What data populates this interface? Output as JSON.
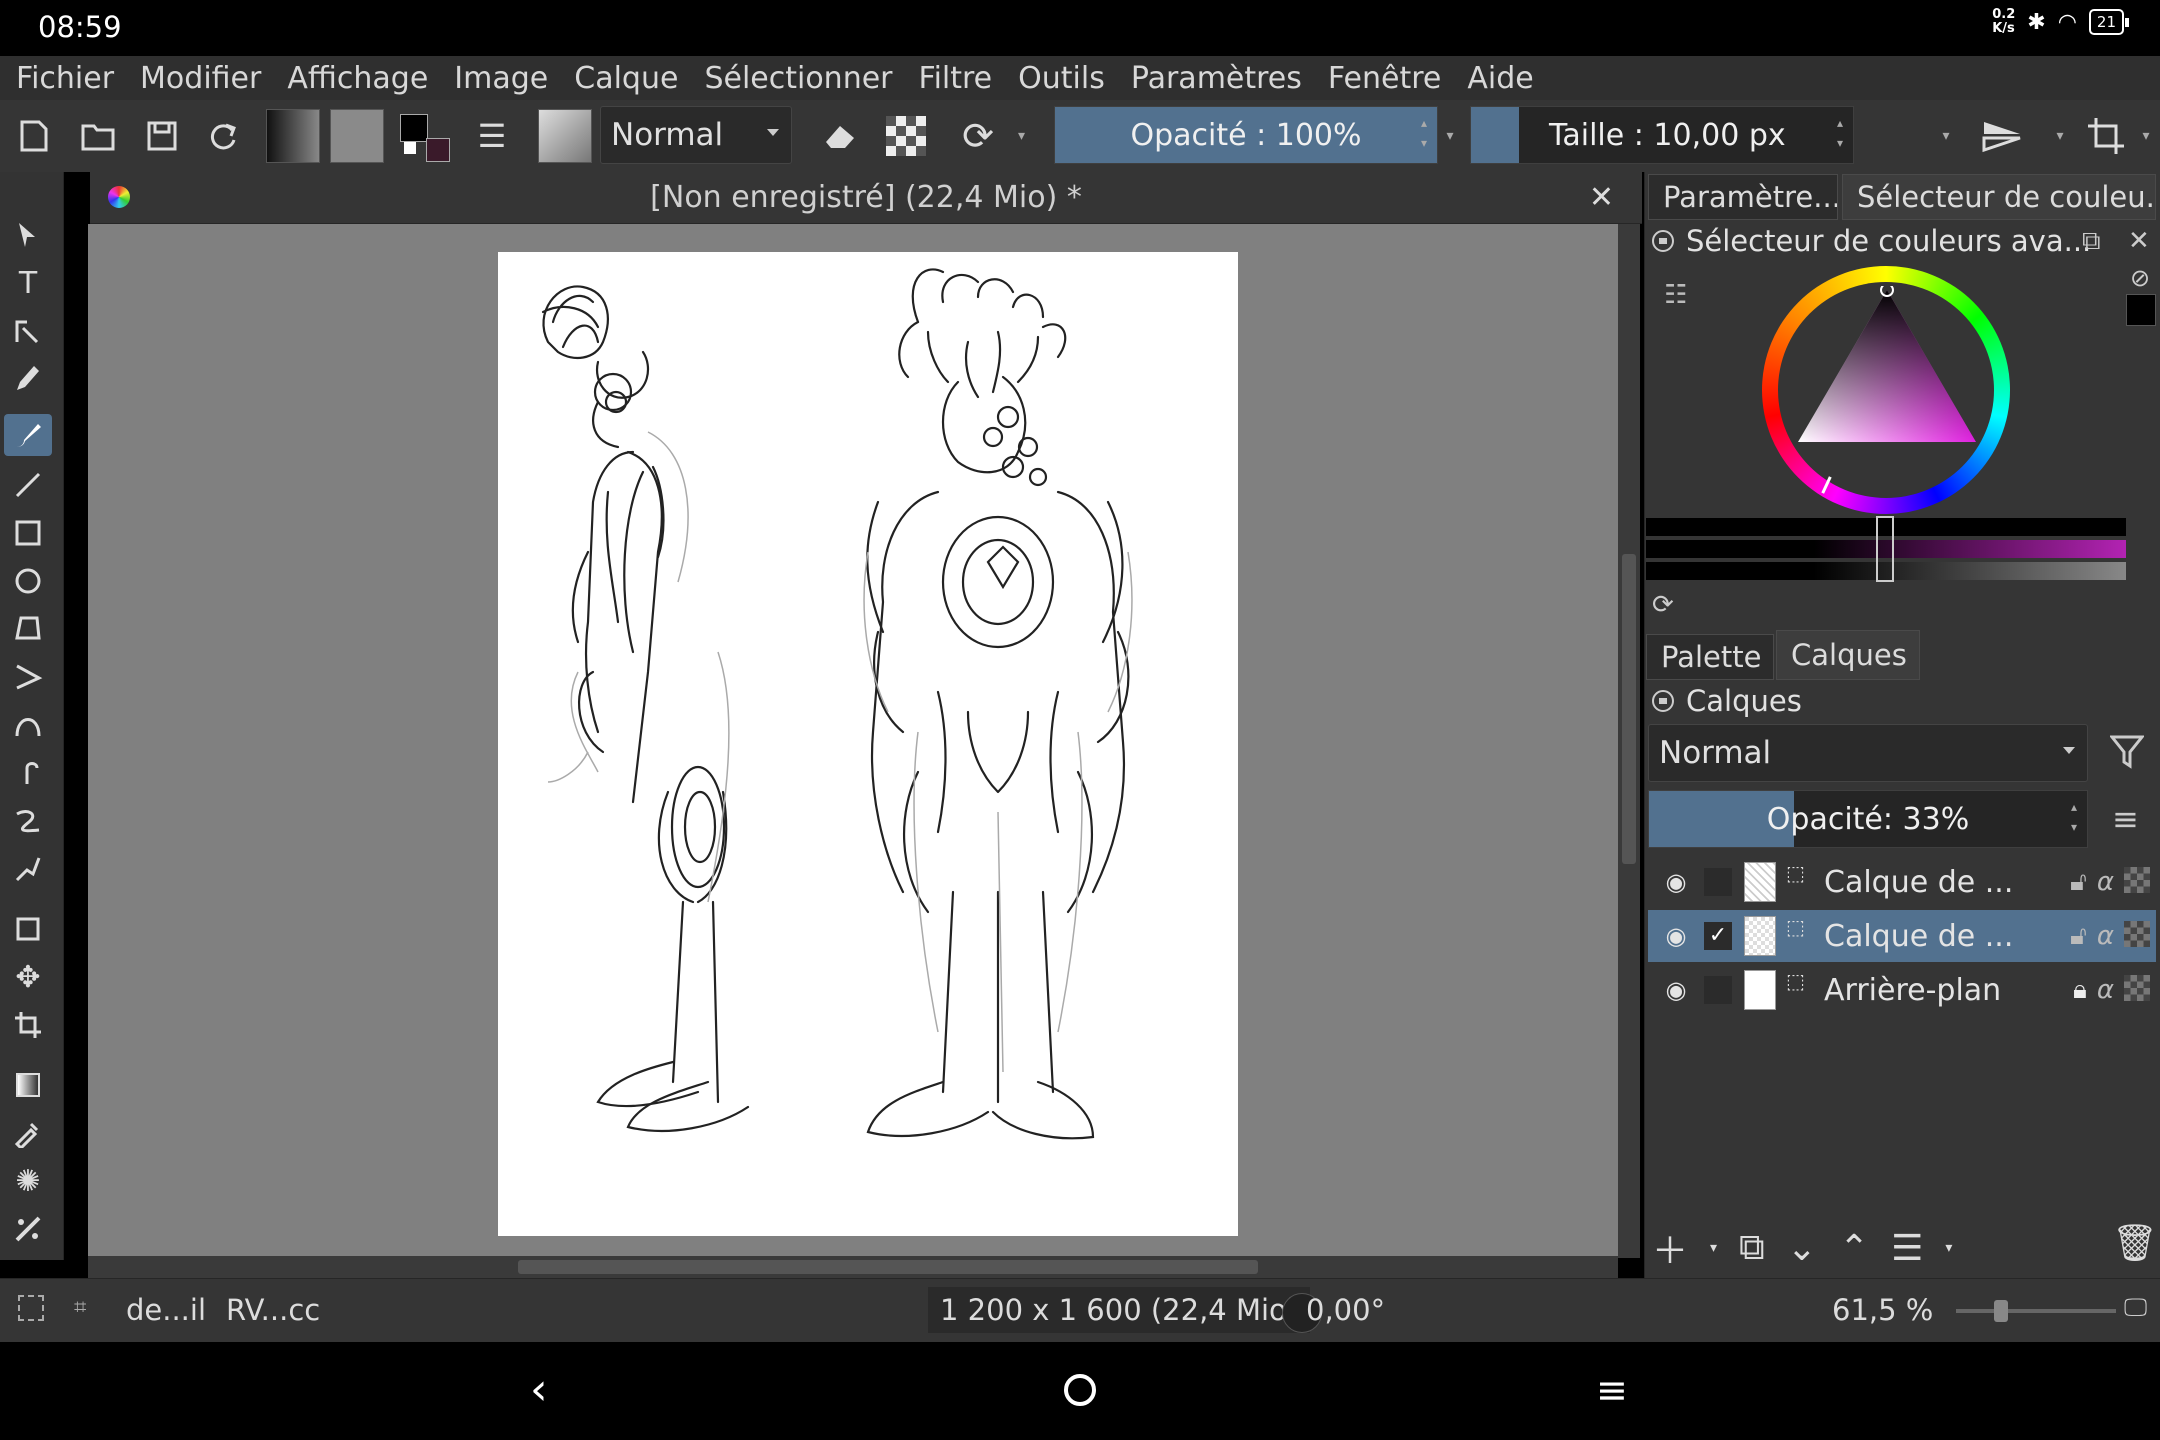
{
  "status": {
    "time": "08:59",
    "net_speed_top": "0.2",
    "net_speed_bottom": "K/s",
    "battery": "21"
  },
  "menu": {
    "items": [
      {
        "label": "Fichier"
      },
      {
        "label": "Modifier"
      },
      {
        "label": "Affichage"
      },
      {
        "label": "Image"
      },
      {
        "label": "Calque"
      },
      {
        "label": "Sélectionner"
      },
      {
        "label": "Filtre"
      },
      {
        "label": "Outils"
      },
      {
        "label": "Paramètres"
      },
      {
        "label": "Fenêtre"
      },
      {
        "label": "Aide"
      }
    ]
  },
  "toolbar": {
    "blend_mode": "Normal",
    "opacity_label": "Opacité : 100%",
    "opacity_value": 1.0,
    "size_label": "Taille : ",
    "size_value": "10,00 px"
  },
  "document": {
    "title": "[Non enregistré]  (22,4 Mio) *"
  },
  "dock": {
    "top_tabs": [
      "Paramètre...",
      "Sélecteur de couleu..."
    ],
    "color_selector_title": "Sélecteur de couleurs ava...",
    "bottom_tabs": [
      "Palette",
      "Calques"
    ],
    "layers_title": "Calques",
    "layers_blend_mode": "Normal",
    "layers_opacity_label": "Opacité:  33%",
    "layers_opacity_value": 0.33,
    "layers": [
      {
        "name": "Calque de ...",
        "selected": false,
        "checked": false
      },
      {
        "name": "Calque de ...",
        "selected": true,
        "checked": true
      },
      {
        "name": "Arrière-plan",
        "selected": false,
        "checked": false
      }
    ],
    "accent_color": "#52718f",
    "hue_color": "#b323b3"
  },
  "statusbar": {
    "brush": "de...il",
    "color_profile": "RV...cc",
    "image_size": "1 200 x 1 600 (22,4 Mio)",
    "rotation": "0,00°",
    "zoom": "61,5 %"
  }
}
